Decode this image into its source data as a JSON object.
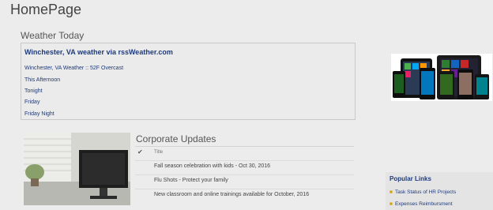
{
  "page": {
    "title": "HomePage"
  },
  "weather": {
    "section_title": "Weather Today",
    "heading": "Winchester, VA weather via rssWeather.com",
    "lines": [
      "Winchester, VA Weather :: 52F Overcast",
      "This Afternoon",
      "Tonight",
      "Friday",
      "Friday Night"
    ]
  },
  "corporate": {
    "section_title": "Corporate Updates",
    "column_header": "Title",
    "items": [
      "Fall season celebration with kids - Oct 30, 2016",
      "Flu Shots - Protect your family",
      "New classroom and online trainings available for October, 2016"
    ]
  },
  "popular_links": {
    "title": "Popular Links",
    "items": [
      "Task Status of HR Projects",
      "Expenses Reimbursment"
    ]
  },
  "icons": {
    "check": "checkmark-icon",
    "bullet": "bullet-icon"
  }
}
